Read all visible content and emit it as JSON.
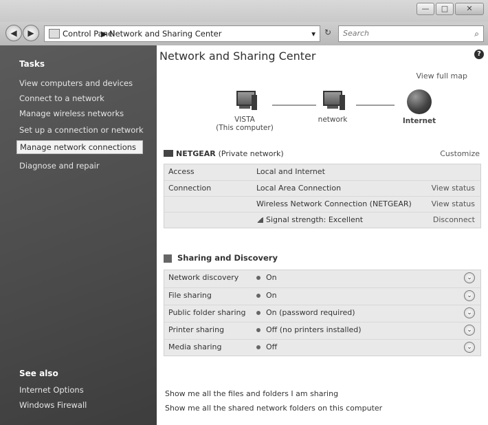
{
  "window": {
    "buttons": {
      "minimize": "—",
      "maximize": "□",
      "close": "✕"
    }
  },
  "nav": {
    "back": "◀",
    "forward": "▶",
    "breadcrumb": [
      "Control Panel",
      "Network and Sharing Center"
    ],
    "breadcrumb_sep": "▶",
    "address_dropdown": "▾",
    "refresh": "↻",
    "search_placeholder": "Search",
    "search_icon": "⌕"
  },
  "sidebar": {
    "tasks_title": "Tasks",
    "items": [
      "View computers and devices",
      "Connect to a network",
      "Manage wireless networks",
      "Set up a connection or network",
      "Manage network connections",
      "Diagnose and repair"
    ],
    "see_also_title": "See also",
    "see_also": [
      "Internet Options",
      "Windows Firewall"
    ]
  },
  "main": {
    "help": "?",
    "title": "Network and Sharing Center",
    "view_full_map": "View full map",
    "map": {
      "computer_name": "VISTA",
      "computer_sub": "(This computer)",
      "network_label": "network",
      "internet_label": "Internet"
    },
    "network": {
      "name": "NETGEAR",
      "type": "(Private network)",
      "customize": "Customize"
    },
    "details": [
      {
        "label": "Access",
        "value": "Local and Internet",
        "action": ""
      },
      {
        "label": "Connection",
        "value": "Local Area Connection",
        "action": "View status"
      },
      {
        "label": "",
        "value": "Wireless Network Connection (NETGEAR)",
        "action": "View status"
      },
      {
        "label": "",
        "value": "Signal strength: Excellent",
        "action": "Disconnect"
      }
    ],
    "sharing_title": "Sharing and Discovery",
    "sharing": [
      {
        "label": "Network discovery",
        "value": "On"
      },
      {
        "label": "File sharing",
        "value": "On"
      },
      {
        "label": "Public folder sharing",
        "value": "On (password required)"
      },
      {
        "label": "Printer sharing",
        "value": "Off (no printers installed)"
      },
      {
        "label": "Media sharing",
        "value": "Off"
      }
    ],
    "chevron": "⌄",
    "links": [
      "Show me all the files and folders I am sharing",
      "Show me all the shared network folders on this computer"
    ]
  }
}
